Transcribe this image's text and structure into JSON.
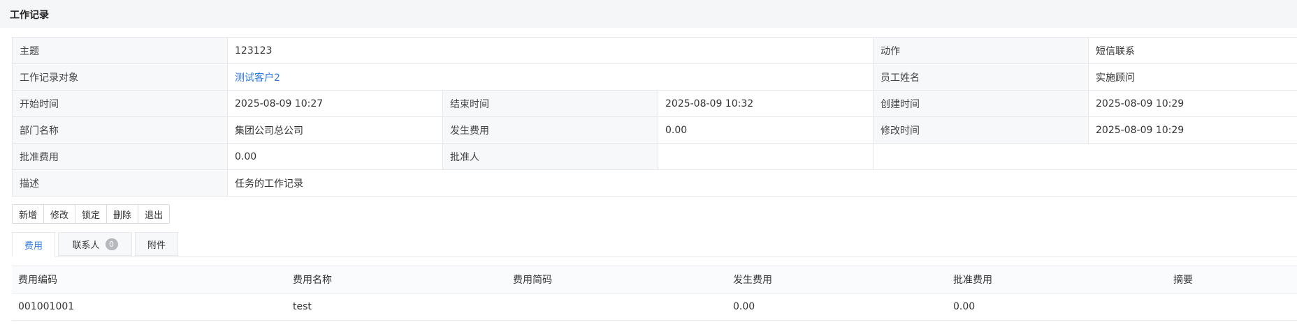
{
  "header": {
    "title": "工作记录"
  },
  "detail": {
    "subject_label": "主题",
    "subject_value": "123123",
    "action_label": "动作",
    "action_value": "短信联系",
    "target_label": "工作记录对象",
    "target_value": "测试客户2",
    "staff_label": "员工姓名",
    "staff_value": "实施顾问",
    "start_label": "开始时间",
    "start_value": "2025-08-09 10:27",
    "end_label": "结束时间",
    "end_value": "2025-08-09 10:32",
    "created_label": "创建时间",
    "created_value": "2025-08-09 10:29",
    "dept_label": "部门名称",
    "dept_value": "集团公司总公司",
    "cost_label": "发生费用",
    "cost_value": "0.00",
    "modified_label": "修改时间",
    "modified_value": "2025-08-09 10:29",
    "approved_cost_label": "批准费用",
    "approved_cost_value": "0.00",
    "approver_label": "批准人",
    "approver_value": "",
    "desc_label": "描述",
    "desc_value": "任务的工作记录"
  },
  "toolbar": {
    "add": "新增",
    "edit": "修改",
    "lock": "锁定",
    "delete": "删除",
    "exit": "退出"
  },
  "tabs": [
    {
      "label": "费用",
      "active": true
    },
    {
      "label": "联系人",
      "badge": "0"
    },
    {
      "label": "附件"
    }
  ],
  "fees_table": {
    "columns": [
      "费用编码",
      "费用名称",
      "费用简码",
      "发生费用",
      "批准费用",
      "摘要"
    ],
    "rows": [
      [
        "001001001",
        "test",
        "",
        "0.00",
        "0.00",
        ""
      ]
    ]
  },
  "colors": {
    "accent": "#2f7ae5",
    "label_bg": "#f7f8fa",
    "border": "#e6e8eb"
  }
}
